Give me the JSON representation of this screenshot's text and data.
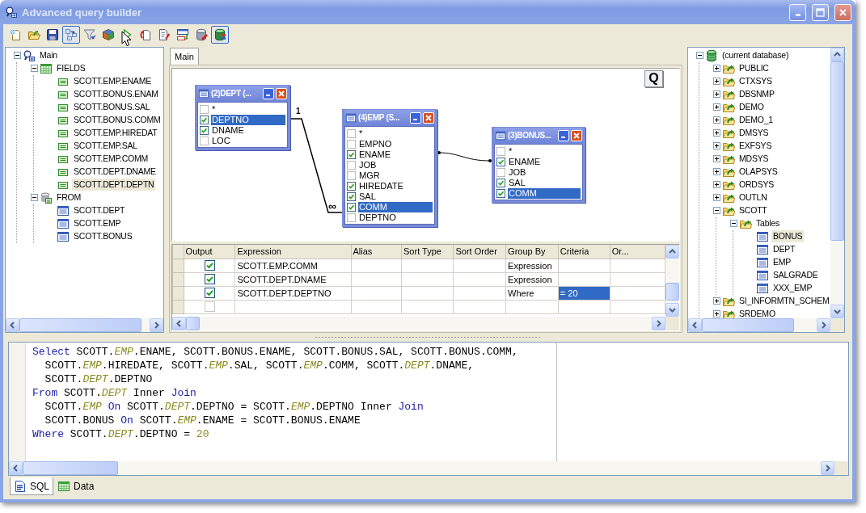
{
  "window": {
    "title": "Advanced query builder"
  },
  "toolbar": [
    {
      "kind": "new",
      "pressed": false
    },
    {
      "kind": "open",
      "pressed": false
    },
    {
      "kind": "save",
      "pressed": false
    },
    {
      "kind": "layout",
      "pressed": true
    },
    {
      "kind": "filter",
      "pressed": false
    },
    {
      "kind": "cube",
      "pressed": false
    },
    {
      "kind": "run",
      "pressed": false
    },
    {
      "kind": "copy",
      "pressed": false
    },
    {
      "kind": "edit",
      "pressed": false
    },
    {
      "kind": "export",
      "pressed": false
    },
    {
      "kind": "database_red",
      "pressed": false
    },
    {
      "kind": "database_green",
      "pressed": true
    }
  ],
  "query_tree": {
    "nodes": [
      {
        "label": "Main",
        "kind": "query",
        "expanded": true,
        "selected": false,
        "children": [
          {
            "label": "FIELDS",
            "kind": "fields",
            "expanded": true,
            "selected": false,
            "children": [
              {
                "label": "SCOTT.EMP.ENAME",
                "kind": "field",
                "selected": false
              },
              {
                "label": "SCOTT.BONUS.ENAM",
                "kind": "field",
                "selected": false
              },
              {
                "label": "SCOTT.BONUS.SAL",
                "kind": "field",
                "selected": false
              },
              {
                "label": "SCOTT.BONUS.COMM",
                "kind": "field",
                "selected": false
              },
              {
                "label": "SCOTT.EMP.HIREDAT",
                "kind": "field",
                "selected": false
              },
              {
                "label": "SCOTT.EMP.SAL",
                "kind": "field",
                "selected": false
              },
              {
                "label": "SCOTT.EMP.COMM",
                "kind": "field",
                "selected": false
              },
              {
                "label": "SCOTT.DEPT.DNAME",
                "kind": "field",
                "selected": false
              },
              {
                "label": "SCOTT.DEPT.DEPTN",
                "kind": "field",
                "selected": true
              }
            ]
          },
          {
            "label": "FROM",
            "kind": "from",
            "expanded": true,
            "selected": false,
            "children": [
              {
                "label": "SCOTT.DEPT",
                "kind": "table",
                "selected": false
              },
              {
                "label": "SCOTT.EMP",
                "kind": "table",
                "selected": false
              },
              {
                "label": "SCOTT.BONUS",
                "kind": "table",
                "selected": false
              }
            ]
          }
        ]
      }
    ]
  },
  "tabs": [
    {
      "label": "Main",
      "selected": true
    }
  ],
  "diagram": {
    "query_button": "Q",
    "tables": [
      {
        "title": "(2)DEPT (...",
        "fields": [
          {
            "name": "*",
            "checked": false,
            "selected": false
          },
          {
            "name": "DEPTNO",
            "checked": true,
            "selected": true
          },
          {
            "name": "DNAME",
            "checked": true,
            "selected": false
          },
          {
            "name": "LOC",
            "checked": false,
            "selected": false
          }
        ]
      },
      {
        "title": "(4)EMP (S...",
        "fields": [
          {
            "name": "*",
            "checked": false,
            "selected": false
          },
          {
            "name": "EMPNO",
            "checked": false,
            "selected": false
          },
          {
            "name": "ENAME",
            "checked": true,
            "selected": false
          },
          {
            "name": "JOB",
            "checked": false,
            "selected": false
          },
          {
            "name": "MGR",
            "checked": false,
            "selected": false
          },
          {
            "name": "HIREDATE",
            "checked": true,
            "selected": false
          },
          {
            "name": "SAL",
            "checked": true,
            "selected": false
          },
          {
            "name": "COMM",
            "checked": true,
            "selected": true
          },
          {
            "name": "DEPTNO",
            "checked": false,
            "selected": false
          }
        ]
      },
      {
        "title": "(3)BONUS...",
        "fields": [
          {
            "name": "*",
            "checked": false,
            "selected": false
          },
          {
            "name": "ENAME",
            "checked": true,
            "selected": false
          },
          {
            "name": "JOB",
            "checked": false,
            "selected": false
          },
          {
            "name": "SAL",
            "checked": true,
            "selected": false
          },
          {
            "name": "COMM",
            "checked": true,
            "selected": true
          }
        ]
      }
    ],
    "links": [
      {
        "kind": "one_to_many",
        "start_label": "1",
        "end_label": "∞"
      },
      {
        "kind": "plain"
      }
    ]
  },
  "grid": {
    "columns": [
      "Output",
      "Expression",
      "Alias",
      "Sort Type",
      "Sort Order",
      "Group By",
      "Criteria",
      "Or..."
    ],
    "rows": [
      {
        "output": true,
        "expression": "SCOTT.EMP.COMM",
        "group_by": "Expression",
        "criteria_selected": false
      },
      {
        "output": true,
        "expression": "SCOTT.DEPT.DNAME",
        "group_by": "Expression",
        "criteria_selected": false
      },
      {
        "output": true,
        "expression": "SCOTT.DEPT.DEPTNO",
        "group_by": "Where",
        "criteria": "= 20",
        "criteria_selected": true
      },
      {
        "output": false,
        "criteria_selected": false
      }
    ]
  },
  "database_tree": {
    "nodes": [
      {
        "label": "(current database)",
        "kind": "database",
        "expanded": true,
        "selected": false,
        "children": [
          {
            "label": "PUBLIC",
            "kind": "schema",
            "expanded": false,
            "selected": false
          },
          {
            "label": "CTXSYS",
            "kind": "schema",
            "expanded": false,
            "selected": false
          },
          {
            "label": "DBSNMP",
            "kind": "schema",
            "expanded": false,
            "selected": false
          },
          {
            "label": "DEMO",
            "kind": "schema",
            "expanded": false,
            "selected": false
          },
          {
            "label": "DEMO_1",
            "kind": "schema",
            "expanded": false,
            "selected": false
          },
          {
            "label": "DMSYS",
            "kind": "schema",
            "expanded": false,
            "selected": false
          },
          {
            "label": "EXFSYS",
            "kind": "schema",
            "expanded": false,
            "selected": false
          },
          {
            "label": "MDSYS",
            "kind": "schema",
            "expanded": false,
            "selected": false
          },
          {
            "label": "OLAPSYS",
            "kind": "schema",
            "expanded": false,
            "selected": false
          },
          {
            "label": "ORDSYS",
            "kind": "schema",
            "expanded": false,
            "selected": false
          },
          {
            "label": "OUTLN",
            "kind": "schema",
            "expanded": false,
            "selected": false
          },
          {
            "label": "SCOTT",
            "kind": "schema",
            "expanded": true,
            "selected": false,
            "children": [
              {
                "label": "Tables",
                "kind": "schema",
                "expanded": true,
                "selected": false,
                "children": [
                  {
                    "label": "BONUS",
                    "kind": "table",
                    "selected": true
                  },
                  {
                    "label": "DEPT",
                    "kind": "table",
                    "selected": false
                  },
                  {
                    "label": "EMP",
                    "kind": "table",
                    "selected": false
                  },
                  {
                    "label": "SALGRADE",
                    "kind": "table",
                    "selected": false
                  },
                  {
                    "label": "XXX_EMP",
                    "kind": "table",
                    "selected": false
                  }
                ]
              }
            ]
          },
          {
            "label": "SI_INFORMTN_SCHEM",
            "kind": "schema",
            "expanded": false,
            "selected": false
          },
          {
            "label": "SRDEMO",
            "kind": "schema",
            "expanded": false,
            "selected": false
          }
        ]
      }
    ]
  },
  "sql": {
    "lines": [
      [
        {
          "kind": "keyword",
          "text": "Select"
        },
        {
          "kind": "text",
          "text": " SCOTT."
        },
        {
          "kind": "alias",
          "text": "EMP"
        },
        {
          "kind": "text",
          "text": ".ENAME, SCOTT.BONUS.ENAME, SCOTT.BONUS.SAL, SCOTT.BONUS.COMM,"
        }
      ],
      [
        {
          "kind": "text",
          "text": "  SCOTT."
        },
        {
          "kind": "alias",
          "text": "EMP"
        },
        {
          "kind": "text",
          "text": ".HIREDATE, SCOTT."
        },
        {
          "kind": "alias",
          "text": "EMP"
        },
        {
          "kind": "text",
          "text": ".SAL, SCOTT."
        },
        {
          "kind": "alias",
          "text": "EMP"
        },
        {
          "kind": "text",
          "text": ".COMM, SCOTT."
        },
        {
          "kind": "alias",
          "text": "DEPT"
        },
        {
          "kind": "text",
          "text": ".DNAME,"
        }
      ],
      [
        {
          "kind": "text",
          "text": "  SCOTT."
        },
        {
          "kind": "alias",
          "text": "DEPT"
        },
        {
          "kind": "text",
          "text": ".DEPTNO"
        }
      ],
      [
        {
          "kind": "keyword",
          "text": "From"
        },
        {
          "kind": "text",
          "text": " SCOTT."
        },
        {
          "kind": "alias",
          "text": "DEPT"
        },
        {
          "kind": "text",
          "text": " Inner "
        },
        {
          "kind": "keyword",
          "text": "Join"
        }
      ],
      [
        {
          "kind": "text",
          "text": "  SCOTT."
        },
        {
          "kind": "alias",
          "text": "EMP"
        },
        {
          "kind": "keyword",
          "text": " On"
        },
        {
          "kind": "text",
          "text": " SCOTT."
        },
        {
          "kind": "alias",
          "text": "DEPT"
        },
        {
          "kind": "text",
          "text": ".DEPTNO = SCOTT."
        },
        {
          "kind": "alias",
          "text": "EMP"
        },
        {
          "kind": "text",
          "text": ".DEPTNO Inner "
        },
        {
          "kind": "keyword",
          "text": "Join"
        }
      ],
      [
        {
          "kind": "text",
          "text": "  SCOTT.BONUS "
        },
        {
          "kind": "keyword",
          "text": "On"
        },
        {
          "kind": "text",
          "text": " SCOTT."
        },
        {
          "kind": "alias",
          "text": "EMP"
        },
        {
          "kind": "text",
          "text": ".ENAME = SCOTT.BONUS.ENAME"
        }
      ],
      [
        {
          "kind": "keyword",
          "text": "Where"
        },
        {
          "kind": "text",
          "text": " SCOTT."
        },
        {
          "kind": "alias",
          "text": "DEPT"
        },
        {
          "kind": "text",
          "text": ".DEPTNO = "
        },
        {
          "kind": "number",
          "text": "20"
        }
      ]
    ]
  },
  "bottom_tabs": [
    {
      "label": "SQL",
      "kind": "sql",
      "selected": true
    },
    {
      "label": "Data",
      "kind": "data",
      "selected": false
    }
  ]
}
